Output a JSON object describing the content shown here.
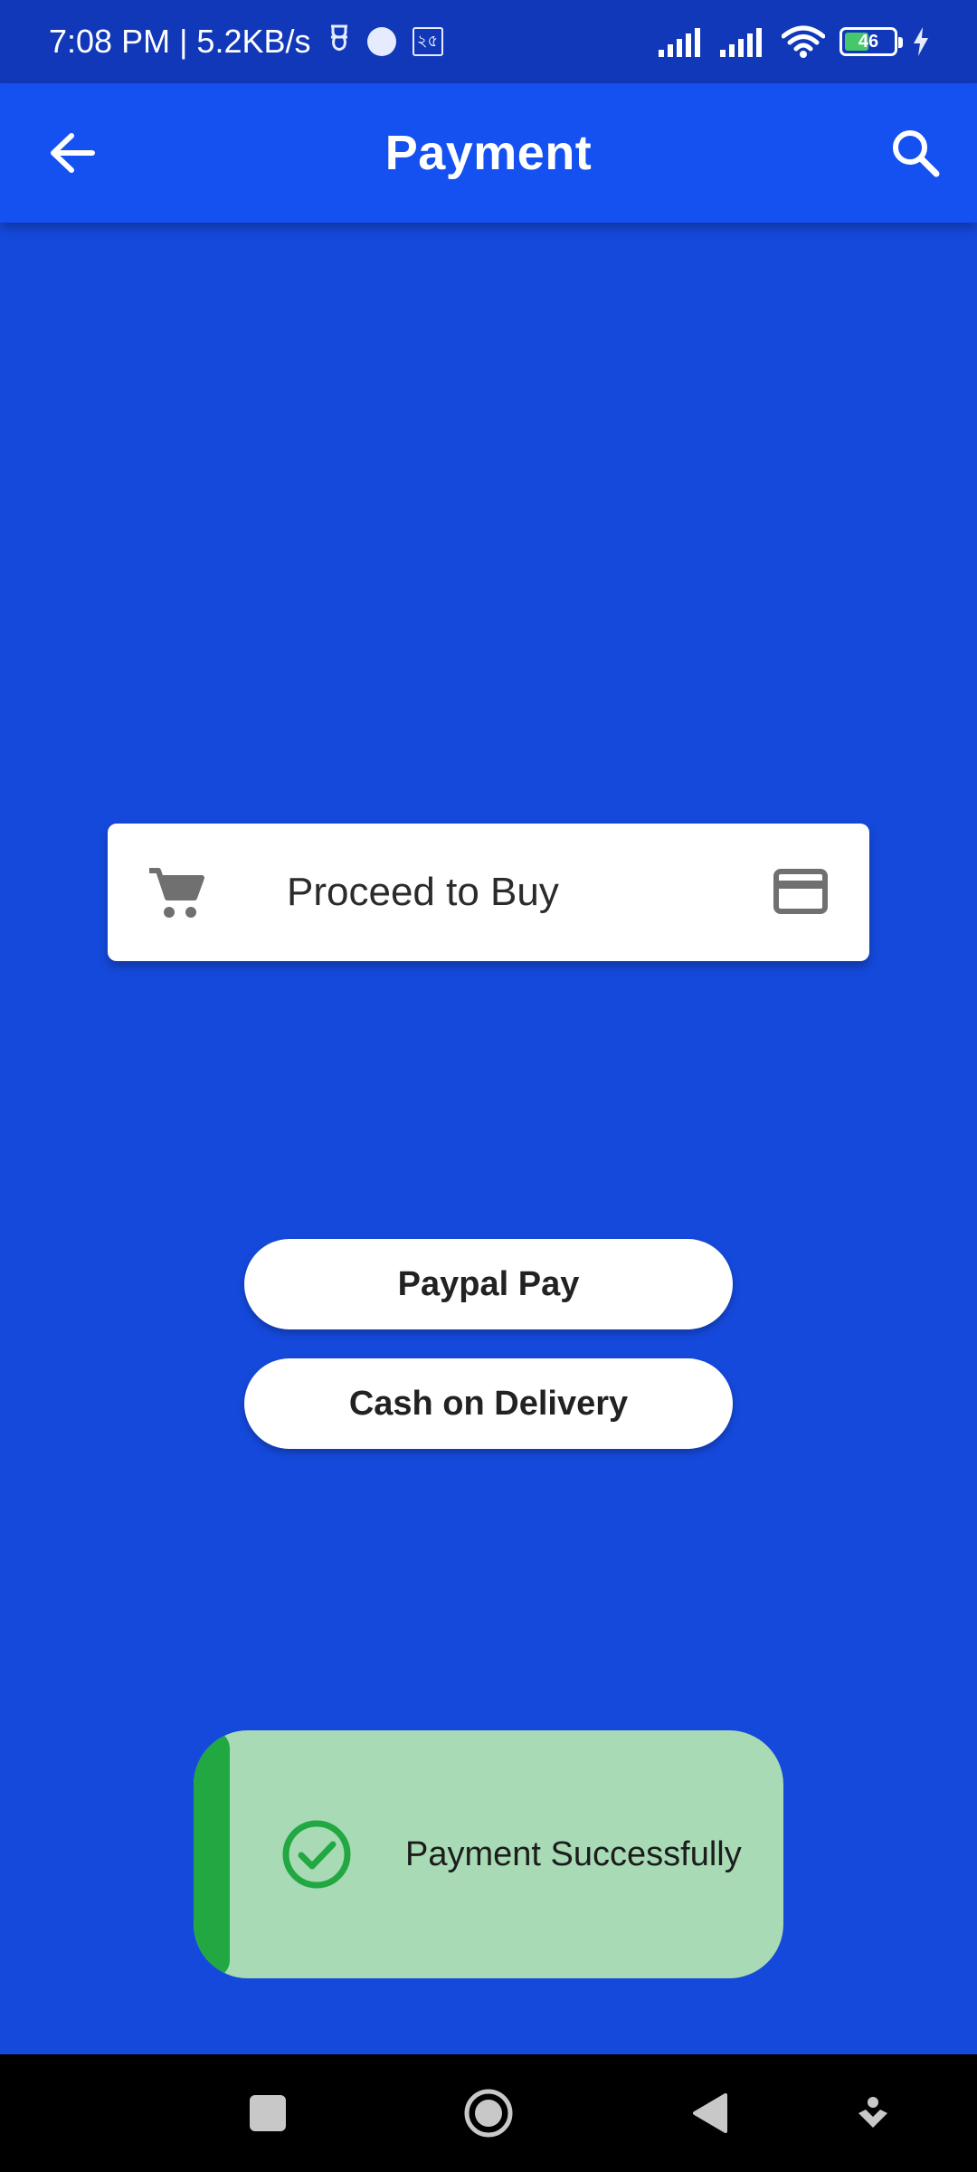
{
  "status_bar": {
    "time_speed": "7:08 PM | 5.2KB/s",
    "box_glyph": "২৫",
    "battery": "46"
  },
  "app_bar": {
    "title": "Payment",
    "back_icon": "arrow-back-icon",
    "search_icon": "search-icon"
  },
  "proceed_card": {
    "label": "Proceed to Buy",
    "left_icon": "cart-icon",
    "right_icon": "credit-card-icon"
  },
  "buttons": {
    "paypal": "Paypal Pay",
    "cod": "Cash on Delivery"
  },
  "toast": {
    "message": "Payment Successfully",
    "icon": "check-circle-icon",
    "accent_color": "#22a843",
    "background_color": "#a8dbb5"
  },
  "colors": {
    "background": "#1549db",
    "app_bar": "#1550f0",
    "status_bar": "#1138b8"
  }
}
